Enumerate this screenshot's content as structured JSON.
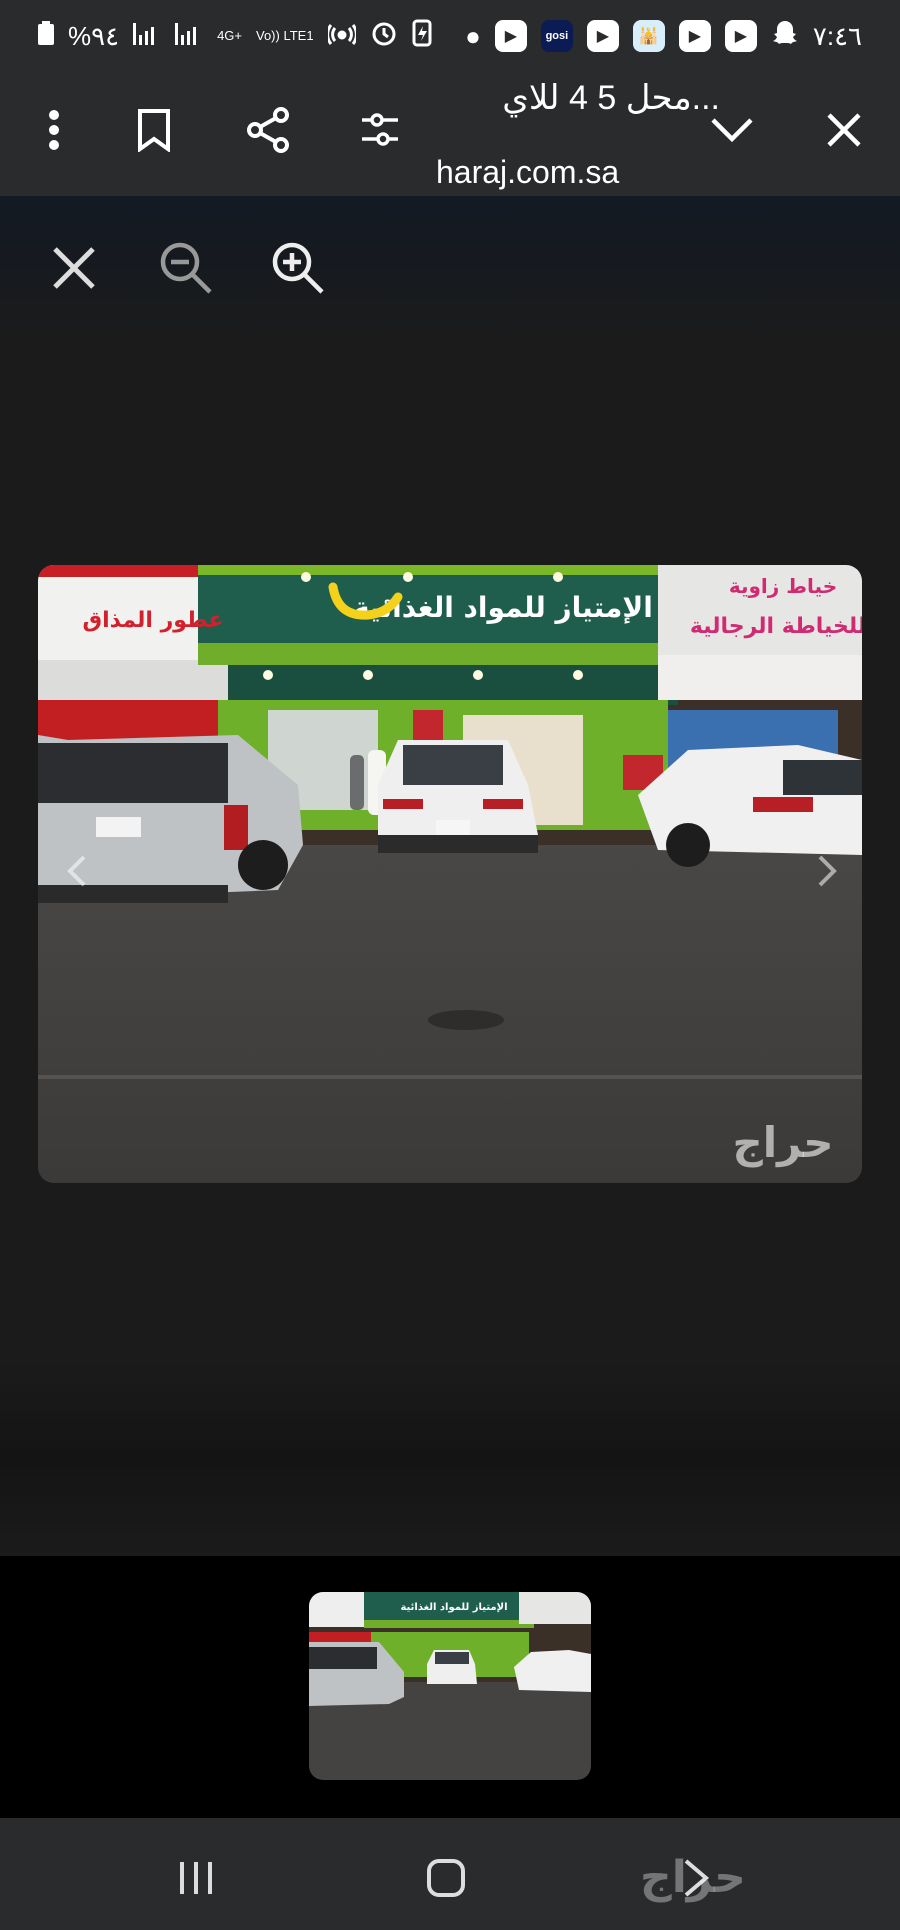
{
  "status_bar": {
    "time": "٧:٤٦",
    "battery_percent": "%٩٤",
    "network_4g": "4G+",
    "volte": "Vo)) LTE1",
    "gosi_label": "gosi"
  },
  "toolbar": {
    "title": "محل 5 4 للاي...",
    "url": "haraj.com.sa"
  },
  "photo": {
    "sign_left": "عطور المذاق",
    "sign_center": "الإمتياز للمواد الغذائية",
    "sign_right_top": "خياط زاوية",
    "sign_right": "للخياطة الرجالية",
    "watermark": "حراج"
  },
  "thumbnail": {
    "sign_center": "الإمتياز للمواد الغذائية"
  },
  "nav_watermark": "حراج"
}
